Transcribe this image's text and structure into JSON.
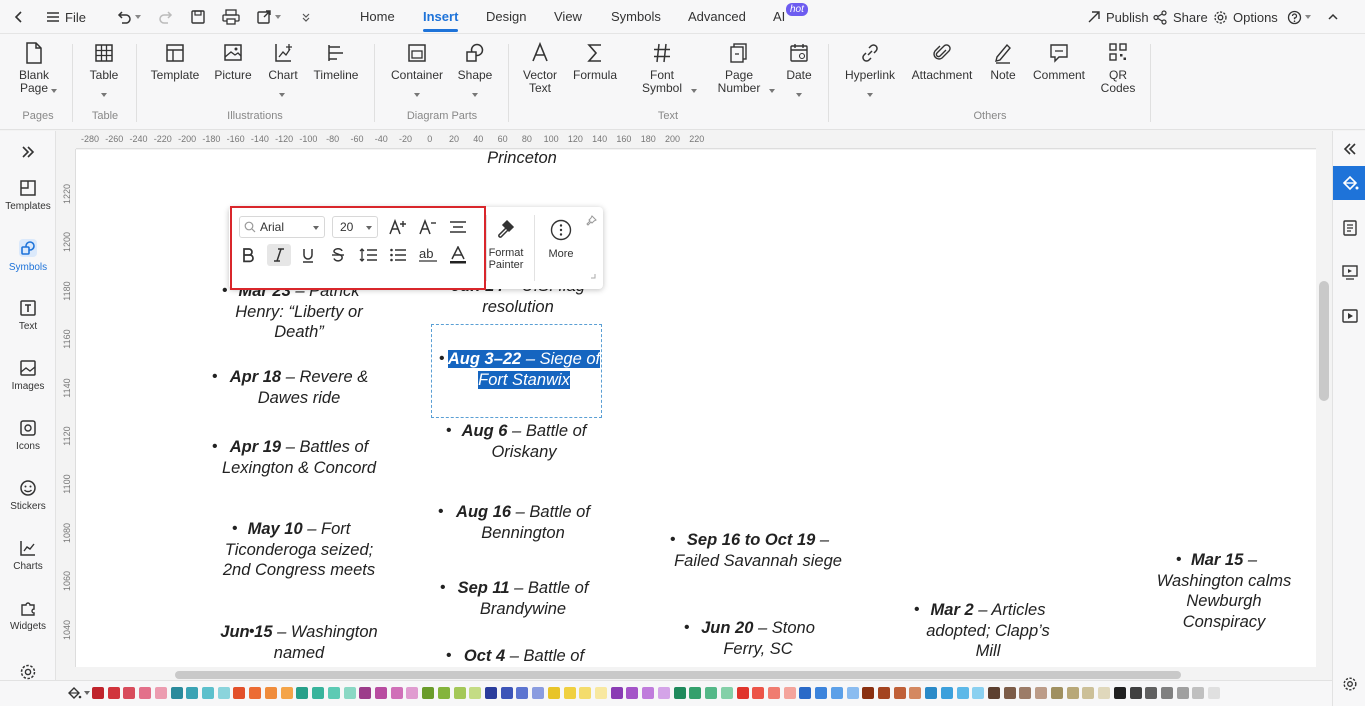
{
  "topbar": {
    "file_label": "File",
    "menus": [
      {
        "label": "Home",
        "active": false
      },
      {
        "label": "Insert",
        "active": true
      },
      {
        "label": "Design",
        "active": false
      },
      {
        "label": "View",
        "active": false
      },
      {
        "label": "Symbols",
        "active": false
      },
      {
        "label": "Advanced",
        "active": false
      },
      {
        "label": "AI",
        "active": false
      }
    ],
    "ai_badge": "hot",
    "publish_label": "Publish",
    "share_label": "Share",
    "options_label": "Options"
  },
  "ribbon": {
    "buttons": {
      "blank_page": "Blank\nPage",
      "table": "Table",
      "template": "Template",
      "picture": "Picture",
      "chart": "Chart",
      "timeline": "Timeline",
      "container": "Container",
      "shape": "Shape",
      "vector_text": "Vector\nText",
      "formula": "Formula",
      "font_symbol": "Font\nSymbol",
      "page_number": "Page\nNumber",
      "date": "Date",
      "hyperlink": "Hyperlink",
      "attachment": "Attachment",
      "note": "Note",
      "comment": "Comment",
      "qr_codes": "QR\nCodes"
    },
    "groups": {
      "pages": "Pages",
      "table": "Table",
      "illustrations": "Illustrations",
      "diagram_parts": "Diagram Parts",
      "text": "Text",
      "others": "Others"
    }
  },
  "left_sidebar": [
    {
      "label": "Templates",
      "icon": "templates-icon"
    },
    {
      "label": "Symbols",
      "icon": "symbols-icon",
      "active": true
    },
    {
      "label": "Text",
      "icon": "text-icon"
    },
    {
      "label": "Images",
      "icon": "images-icon"
    },
    {
      "label": "Icons",
      "icon": "icons-icon"
    },
    {
      "label": "Stickers",
      "icon": "stickers-icon"
    },
    {
      "label": "Charts",
      "icon": "charts-icon"
    },
    {
      "label": "Widgets",
      "icon": "widgets-icon"
    }
  ],
  "rulers": {
    "horizontal": [
      "-280",
      "-260",
      "-240",
      "-220",
      "-200",
      "-180",
      "-160",
      "-140",
      "-120",
      "-100",
      "-80",
      "-60",
      "-40",
      "-20",
      "0",
      "20",
      "40",
      "60",
      "80",
      "100",
      "120",
      "140",
      "160",
      "180",
      "200",
      "220"
    ],
    "vertical": [
      "1220",
      "1200",
      "1180",
      "1160",
      "1140",
      "1120",
      "1100",
      "1080",
      "1060",
      "1040"
    ]
  },
  "floating_toolbar": {
    "font_name": "Arial",
    "font_size": "20",
    "format_painter": "Format\nPainter",
    "more": "More"
  },
  "canvas": {
    "top_label": "Princeton",
    "events": {
      "mar23_date": "Mar 23",
      "mar23_text": " – Patrick Henry: “Liberty or Death”",
      "apr18_date": "Apr 18",
      "apr18_text": " – Revere & Dawes ride",
      "apr19_date": "Apr 19",
      "apr19_text": " – Battles of Lexington & Concord",
      "may10_date": "May 10",
      "may10_text": " – Fort Ticonderoga seized; 2nd Congress meets",
      "jun15_date": "Jun 15",
      "jun15_text": " – Washington named",
      "jun14_date": "Jun 14",
      "jun14_text": " – U.S. flag resolution",
      "aug3_date": "Aug 3–22",
      "aug3_text": " – Siege of Fort Stanwix",
      "aug6_date": "Aug 6",
      "aug6_text": " – Battle of Oriskany",
      "aug16_date": "Aug 16",
      "aug16_text": " – Battle of Bennington",
      "sep11_date": "Sep 11",
      "sep11_text": " – Battle of Brandywine",
      "oct4_date": "Oct 4",
      "oct4_text": " – Battle of",
      "sep16_date": "Sep 16 to Oct 19",
      "sep16_text": " – Failed Savannah siege",
      "jun20_date": "Jun 20",
      "jun20_text": " – Stono Ferry, SC",
      "mar2_date": "Mar 2",
      "mar2_text": " – Articles adopted; Clapp’s Mill",
      "mar15_date": "Mar 15",
      "mar15_text": " – Washington calms Newburgh Conspiracy"
    }
  },
  "palette": [
    "#c0242c",
    "#d1343c",
    "#d84c5c",
    "#e3708a",
    "#ec9cb0",
    "#2a8a9c",
    "#3aa3b4",
    "#5cc0cc",
    "#8ad4dc",
    "#e3502a",
    "#ec6c34",
    "#f08c3c",
    "#f4a448",
    "#27a08a",
    "#38b49c",
    "#5ccab4",
    "#8ad8c4",
    "#9c3c8a",
    "#b84ca0",
    "#d070b8",
    "#e09cd0",
    "#6a9c2a",
    "#84b43c",
    "#a4c858",
    "#c4dc84",
    "#2a3c9c",
    "#3c54b8",
    "#5c74d0",
    "#8a9ce0",
    "#e8c428",
    "#f0d040",
    "#f4dc6c",
    "#f8e8a0",
    "#8a3cb4",
    "#a454c8",
    "#c07cdc",
    "#d4a4e8",
    "#1f8a5c",
    "#34a06c",
    "#54b888",
    "#84d0a8",
    "#e0342c",
    "#ec5448",
    "#f07c70",
    "#f4a49c",
    "#2a6ac8",
    "#3c84dc",
    "#5ca0e8",
    "#8abcf0",
    "#8a3010",
    "#a44420",
    "#c06038",
    "#d48860",
    "#2a8ac8",
    "#3ca0dc",
    "#5cb8e8",
    "#8ad0f0",
    "#5c4030",
    "#7c5c48",
    "#9c7c68",
    "#bc9c88",
    "#a09060",
    "#b8a878",
    "#ccc098",
    "#e0d8bc",
    "#202020",
    "#404040",
    "#606060",
    "#808080",
    "#a0a0a0",
    "#c0c0c0",
    "#e0e0e0"
  ]
}
